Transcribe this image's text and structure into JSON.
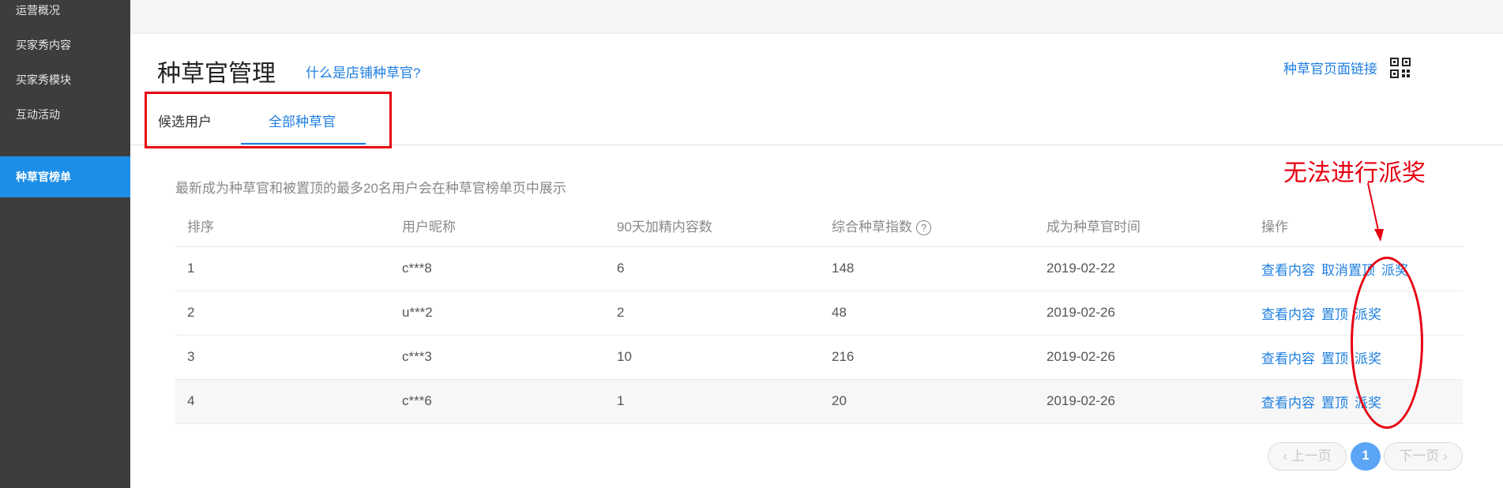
{
  "sidebar": {
    "items": [
      {
        "label": "运营概况"
      },
      {
        "label": "买家秀内容"
      },
      {
        "label": "买家秀模块"
      },
      {
        "label": "互动活动"
      },
      {
        "label": "种草官榜单"
      }
    ]
  },
  "header": {
    "title": "种草官管理",
    "help_link": "什么是店铺种草官?",
    "page_link": "种草官页面链接"
  },
  "tabs": [
    {
      "label": "候选用户"
    },
    {
      "label": "全部种草官"
    }
  ],
  "notice": "最新成为种草官和被置顶的最多20名用户会在种草官榜单页中展示",
  "table": {
    "headers": [
      "排序",
      "用户昵称",
      "90天加精内容数",
      "综合种草指数",
      "成为种草官时间",
      "操作"
    ],
    "help_glyph": "?",
    "rows": [
      {
        "rank": "1",
        "nick": "c***8",
        "count": "6",
        "index": "148",
        "date": "2019-02-22",
        "actions": [
          "查看内容",
          "取消置顶",
          "派奖"
        ]
      },
      {
        "rank": "2",
        "nick": "u***2",
        "count": "2",
        "index": "48",
        "date": "2019-02-26",
        "actions": [
          "查看内容",
          "置顶",
          "派奖"
        ]
      },
      {
        "rank": "3",
        "nick": "c***3",
        "count": "10",
        "index": "216",
        "date": "2019-02-26",
        "actions": [
          "查看内容",
          "置顶",
          "派奖"
        ]
      },
      {
        "rank": "4",
        "nick": "c***6",
        "count": "1",
        "index": "20",
        "date": "2019-02-26",
        "actions": [
          "查看内容",
          "置顶",
          "派奖"
        ]
      }
    ]
  },
  "pagination": {
    "prev": "‹ 上一页",
    "current": "1",
    "next": "下一页 ›"
  },
  "annotation": {
    "text": "无法进行派奖",
    "color": "#e60012"
  },
  "colors": {
    "accent": "#1f7fe0",
    "sidebar_bg": "#3d3d3d",
    "sidebar_active": "#1c8ee8"
  }
}
